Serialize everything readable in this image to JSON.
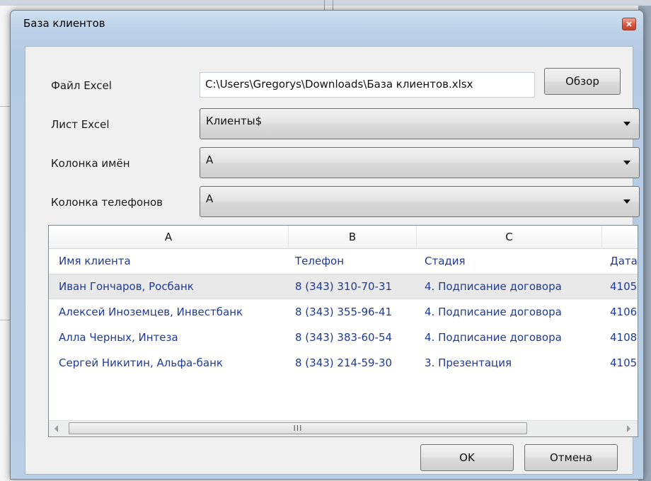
{
  "window": {
    "title": "База клиентов"
  },
  "form": {
    "file_label": "Файл Excel",
    "file_path": "C:\\Users\\Gregorys\\Downloads\\База клиентов.xlsx",
    "browse_label": "Обзор",
    "sheet_label": "Лист Excel",
    "sheet_value": "Клиенты$",
    "names_label": "Колонка имён",
    "names_value": "A",
    "phones_label": "Колонка телефонов",
    "phones_value": "A"
  },
  "grid": {
    "columns": [
      "A",
      "B",
      "C"
    ],
    "field_names": [
      "Имя клиента",
      "Телефон",
      "Стадия",
      "Дата"
    ],
    "rows": [
      [
        "Иван Гончаров, Росбанк",
        "8 (343) 310-70-31",
        "4. Подписание договора",
        "4105"
      ],
      [
        "Алексей Иноземцев, Инвестбанк",
        "8 (343) 355-96-41",
        "4. Подписание договора",
        "4106"
      ],
      [
        "Алла Черных, Интеза",
        "8 (343) 383-60-54",
        "4. Подписание договора",
        "4108"
      ],
      [
        "Сергей Никитин, Альфа-банк",
        "8 (343) 214-59-30",
        "3. Презентация",
        "4105"
      ]
    ],
    "selected_row": 0,
    "scroll_grip": "III"
  },
  "footer": {
    "ok_label": "OK",
    "cancel_label": "Отмена"
  },
  "icons": {
    "close": "close-icon",
    "dropdown": "chevron-down-icon"
  },
  "colors": {
    "cell_text": "#1f3a93",
    "titlebar": "#bcd1e8",
    "close_button": "#d9573f"
  }
}
